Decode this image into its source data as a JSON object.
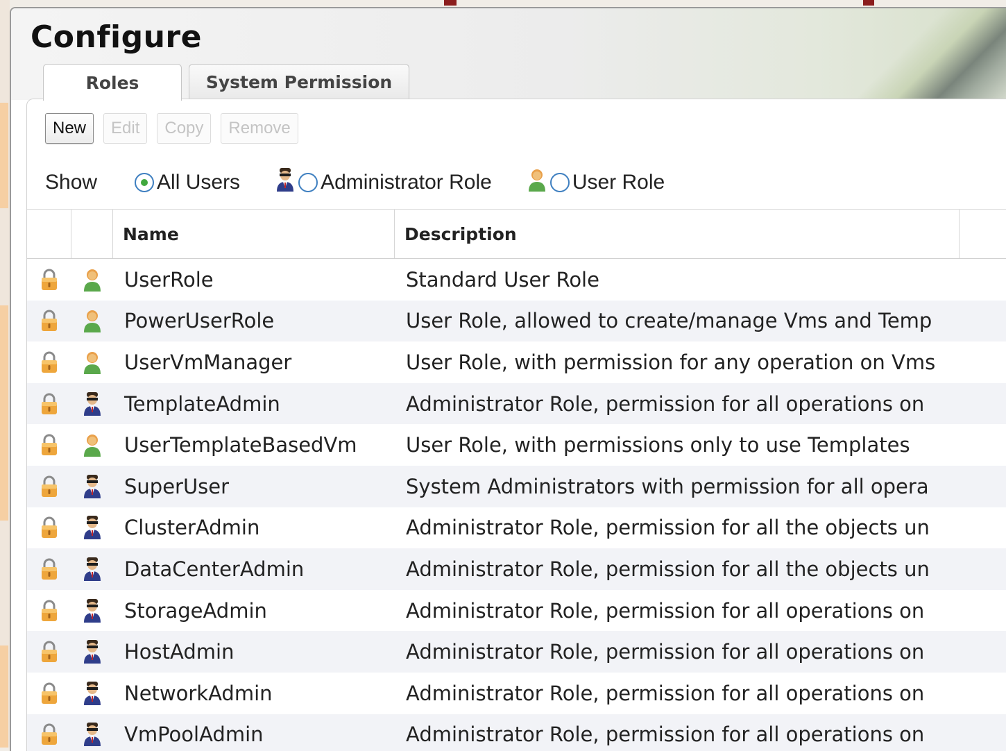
{
  "window": {
    "title": "Configure"
  },
  "tabs": [
    {
      "label": "Roles",
      "active": true
    },
    {
      "label": "System Permission",
      "active": false
    }
  ],
  "toolbar": {
    "new_label": "New",
    "edit_label": "Edit",
    "copy_label": "Copy",
    "remove_label": "Remove"
  },
  "filter": {
    "show_label": "Show",
    "options": [
      {
        "label": "All Users",
        "selected": true,
        "icon": "none"
      },
      {
        "label": "Administrator Role",
        "selected": false,
        "icon": "admin-user-icon"
      },
      {
        "label": "User Role",
        "selected": false,
        "icon": "user-icon"
      }
    ]
  },
  "grid": {
    "columns": [
      "",
      "",
      "Name",
      "Description"
    ],
    "rows": [
      {
        "locked": true,
        "role_type": "user",
        "name": "UserRole",
        "description": "Standard User Role"
      },
      {
        "locked": true,
        "role_type": "user",
        "name": "PowerUserRole",
        "description": "User Role, allowed to create/manage Vms and Temp"
      },
      {
        "locked": true,
        "role_type": "user",
        "name": "UserVmManager",
        "description": "User Role, with permission for any operation on Vms"
      },
      {
        "locked": true,
        "role_type": "admin",
        "name": "TemplateAdmin",
        "description": "Administrator Role, permission for all operations on"
      },
      {
        "locked": true,
        "role_type": "user",
        "name": "UserTemplateBasedVm",
        "description": "User Role, with permissions only to use Templates"
      },
      {
        "locked": true,
        "role_type": "admin",
        "name": "SuperUser",
        "description": "System Administrators with permission for all opera"
      },
      {
        "locked": true,
        "role_type": "admin",
        "name": "ClusterAdmin",
        "description": "Administrator Role, permission for all the objects un"
      },
      {
        "locked": true,
        "role_type": "admin",
        "name": "DataCenterAdmin",
        "description": "Administrator Role, permission for all the objects un"
      },
      {
        "locked": true,
        "role_type": "admin",
        "name": "StorageAdmin",
        "description": "Administrator Role, permission for all operations on"
      },
      {
        "locked": true,
        "role_type": "admin",
        "name": "HostAdmin",
        "description": "Administrator Role, permission for all operations on"
      },
      {
        "locked": true,
        "role_type": "admin",
        "name": "NetworkAdmin",
        "description": "Administrator Role, permission for all operations on"
      },
      {
        "locked": true,
        "role_type": "admin",
        "name": "VmPoolAdmin",
        "description": "Administrator Role, permission for all operations on"
      }
    ]
  },
  "colors": {
    "radio_border": "#3e7fc0",
    "radio_selected": "#41a83e",
    "row_alt": "#f2f3f7",
    "lock": "#e9a43a",
    "user_icon": "#e0913a",
    "admin_icon": "#2f3d8a"
  }
}
